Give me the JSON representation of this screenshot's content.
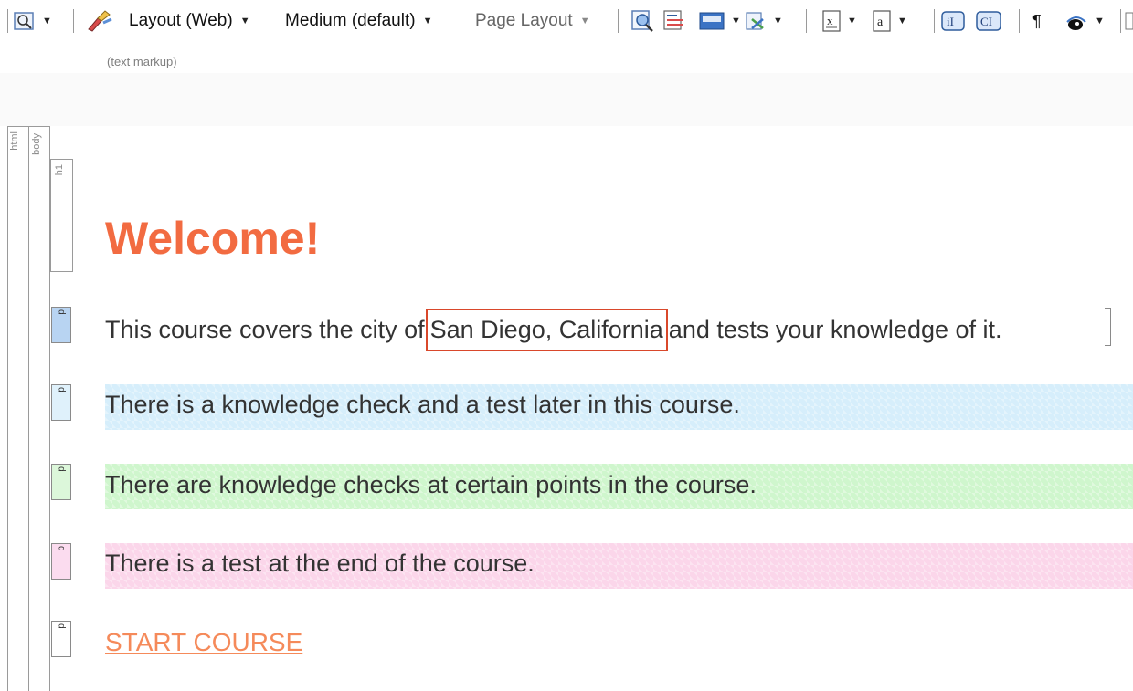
{
  "toolbar": {
    "layout_label": "Layout (Web)",
    "medium_label": "Medium (default)",
    "page_layout_label": "Page Layout",
    "markup_hint": "(text markup)",
    "pilcrow": "¶"
  },
  "structure": {
    "html_label": "html",
    "body_label": "body",
    "h1_label": "h1",
    "p_label": "p"
  },
  "content": {
    "heading": "Welcome!",
    "intro_before": "This course covers the city of",
    "intro_highlight": "San Diego, California",
    "intro_after": "and tests your knowledge of it.",
    "line_blue": "There is a knowledge check and a test later in this course.",
    "line_green": "There are knowledge checks at certain points in the course.",
    "line_pink": "There is a test at the end of the course.",
    "start_link": "START COURSE"
  },
  "colors": {
    "heading": "#f26b41",
    "highlight_box": "#d9482b",
    "band_blue": "#d6eefb",
    "band_green": "#cff6cd",
    "band_pink": "#fbd6ea",
    "link": "#f58a5a"
  }
}
